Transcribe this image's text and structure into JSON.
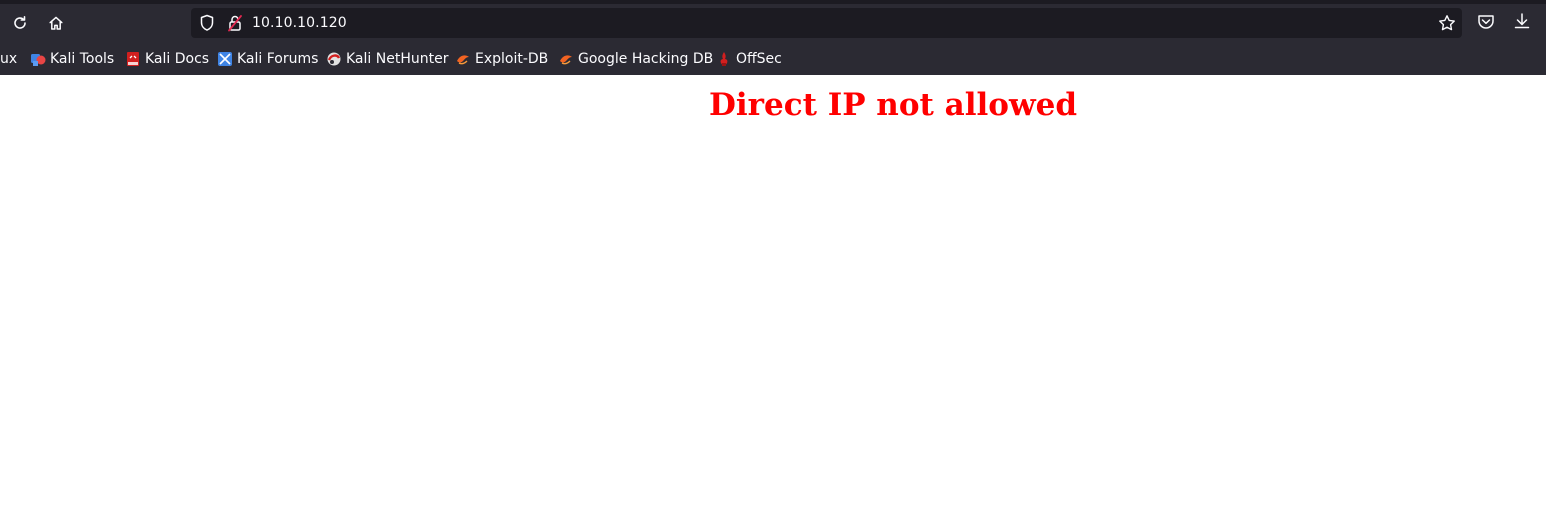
{
  "browser": {
    "url": "10.10.10.120",
    "toolbar_icons": [
      "reload-icon",
      "home-icon",
      "shield-icon",
      "lock-icon",
      "star-icon",
      "pocket-icon",
      "download-icon"
    ]
  },
  "bookmarks": {
    "items": [
      {
        "label": "ux",
        "icon": "kali-linux-icon"
      },
      {
        "label": "Kali Tools",
        "icon": "kali-tools-icon"
      },
      {
        "label": "Kali Docs",
        "icon": "kali-docs-icon"
      },
      {
        "label": "Kali Forums",
        "icon": "kali-forums-icon"
      },
      {
        "label": "Kali NetHunter",
        "icon": "kali-nethunter-icon"
      },
      {
        "label": "Exploit-DB",
        "icon": "exploit-db-icon"
      },
      {
        "label": "Google Hacking DB",
        "icon": "ghdb-icon"
      },
      {
        "label": "OffSec",
        "icon": "offsec-icon"
      }
    ]
  },
  "page": {
    "heading": "Direct IP not allowed"
  },
  "colors": {
    "chrome": "#2b2a33",
    "urlbar": "#1c1b22",
    "heading": "#ff0000"
  }
}
